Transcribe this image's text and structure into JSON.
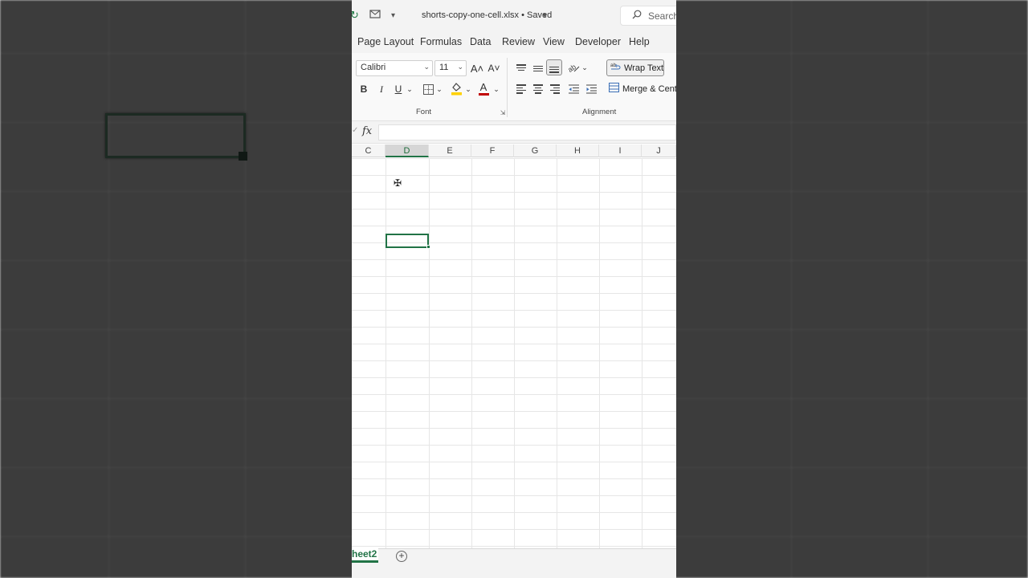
{
  "window": {
    "doc_title": "shorts-copy-one-cell.xlsx • Saved",
    "search_placeholder": "Search"
  },
  "ribbon_tabs": [
    "Page Layout",
    "Formulas",
    "Data",
    "Review",
    "View",
    "Developer",
    "Help"
  ],
  "font_group": {
    "font_name": "Calibri",
    "font_size": "11",
    "bold": "B",
    "italic": "I",
    "underline": "U",
    "increase_font": "A˄",
    "decrease_font": "A˅",
    "font_color_letter": "A",
    "label": "Font"
  },
  "alignment_group": {
    "wrap_text": "Wrap Text",
    "merge_center": "Merge & Cente",
    "label": "Alignment"
  },
  "formula_bar": {
    "fx": "fx",
    "value": ""
  },
  "columns": [
    "C",
    "D",
    "E",
    "F",
    "G",
    "H",
    "I",
    "J"
  ],
  "active_column": "D",
  "sheet_tabs": {
    "active": "heet2"
  },
  "colors": {
    "accent": "#217346",
    "fill_yellow": "#ffd100",
    "font_red": "#c00000"
  }
}
